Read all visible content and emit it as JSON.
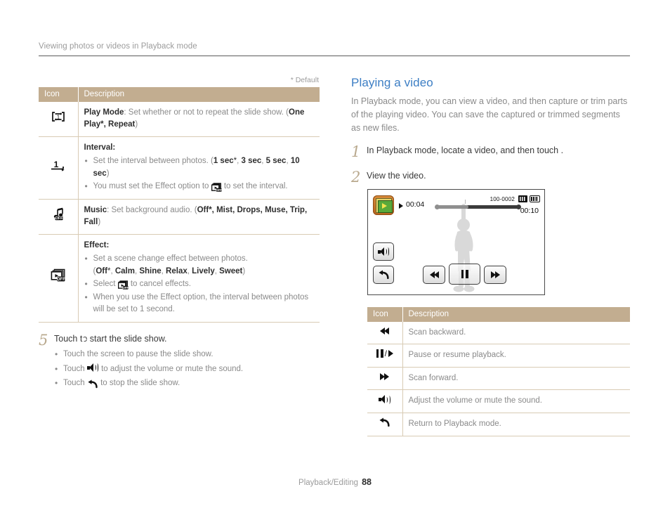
{
  "header": {
    "title": "Viewing photos or videos in Playback mode"
  },
  "left_column": {
    "default_note": "* Default",
    "table": {
      "columns": [
        "Icon",
        "Description"
      ],
      "rows": [
        {
          "icon_name": "play-mode-repeat-icon",
          "icon_glyph": "one-play-loop",
          "title": "Play Mode",
          "text": ": Set whether or not to repeat the slide show. (",
          "bold_options": "One Play*, Repeat",
          "tail": ")"
        },
        {
          "icon_name": "interval-icon",
          "icon_glyph": "1-underline",
          "title": "Interval:",
          "bullets": [
            "Set the interval between photos. (1 sec*, 3 sec, 5 sec, 10 sec)",
            "You must set the Effect option to [effect-off-icon] to set the interval."
          ]
        },
        {
          "icon_name": "music-off-icon",
          "icon_glyph": "note-off",
          "title": "Music",
          "text": ": Set background audio. (",
          "bold_options": "Off*, Mist, Drops, Muse, Trip, Fall",
          "tail": ")"
        },
        {
          "icon_name": "effect-off-icon",
          "icon_glyph": "effect-off",
          "title": "Effect:",
          "bullets": [
            "Set a scene change effect between photos. (Off*, Calm, Shine, Relax, Lively, Sweet)",
            "Select [effect-off-icon] to cancel effects.",
            "When you use the Effect option, the interval between photos will be set to 1 second."
          ]
        }
      ]
    },
    "step": {
      "number": "5",
      "lead_pre": "Touch ",
      "lead_post": " to start the slide show.",
      "bullets": [
        "Touch the screen to pause the slide show.",
        "Touch [speaker-icon] to adjust the volume or mute the sound.",
        "Touch [return-icon] to stop the slide show."
      ]
    }
  },
  "right_column": {
    "section_title": "Playing a video",
    "intro": "In Playback mode, you can view a video, and then capture or trim parts of the playing video. You can save the captured or trimmed segments as new files.",
    "steps": [
      {
        "number": "1",
        "text_pre": "In Playback mode, locate a video, and then touch ",
        "text_post": "."
      },
      {
        "number": "2",
        "text_pre": "View the video.",
        "text_post": ""
      }
    ],
    "screen": {
      "current_time": "00:04",
      "total_time": "00:10",
      "file_number": "100-0002",
      "thumbnail_name": "video-thumbnail-icon",
      "memory_icon_name": "memory-card-icon",
      "battery_icon_name": "battery-icon",
      "buttons": [
        {
          "name": "volume-button",
          "glyph": "speaker"
        },
        {
          "name": "back-button",
          "glyph": "return-arrow"
        },
        {
          "name": "rewind-button",
          "glyph": "scan-backward"
        },
        {
          "name": "pause-button",
          "glyph": "pause"
        },
        {
          "name": "forward-button",
          "glyph": "scan-forward"
        }
      ]
    },
    "table": {
      "columns": [
        "Icon",
        "Description"
      ],
      "rows": [
        {
          "icon_name": "scan-backward-icon",
          "glyph": "rewind",
          "description": "Scan backward."
        },
        {
          "icon_name": "pause-resume-icon",
          "glyph": "pauseplay",
          "description": "Pause or resume playback."
        },
        {
          "icon_name": "scan-forward-icon",
          "glyph": "forward",
          "description": "Scan forward."
        },
        {
          "icon_name": "volume-icon",
          "glyph": "speaker",
          "description": "Adjust the volume or mute the sound."
        },
        {
          "icon_name": "return-icon",
          "glyph": "return",
          "description": "Return to Playback mode."
        }
      ]
    }
  },
  "footer": {
    "chapter": "Playback/Editing",
    "page_number": "88"
  },
  "colors": {
    "table_header": "#c2ad90",
    "table_border": "#d8cbb4",
    "heading_blue": "#3c7ec4",
    "body_gray": "#8a8a8a"
  }
}
